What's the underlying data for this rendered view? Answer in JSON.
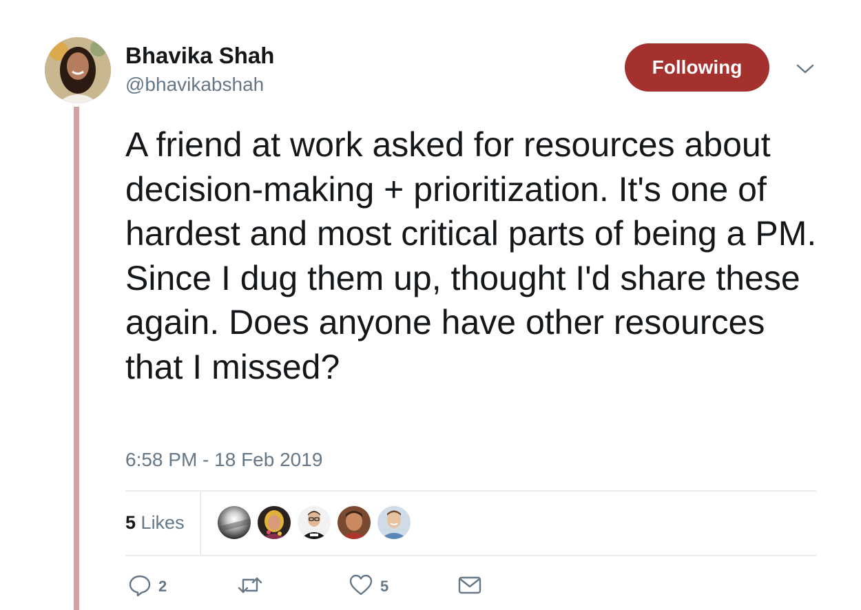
{
  "author": {
    "display_name": "Bhavika Shah",
    "handle": "@bhavikabshah"
  },
  "follow_button_label": "Following",
  "tweet": {
    "text": "A friend at work asked for resources about decision-making + prioritization. It's one of hardest and most critical parts of being a PM. Since I dug them up, thought I'd share these again. Does anyone have other resources that I missed?",
    "timestamp": "6:58 PM - 18 Feb 2019"
  },
  "likes": {
    "count": "5",
    "label": "Likes"
  },
  "actions": {
    "reply_count": "2",
    "retweet_count": "",
    "like_count": "5"
  },
  "colors": {
    "following_button": "#a5312f",
    "thread_line": "#d3a1a1",
    "secondary_text": "#657786"
  },
  "icons": [
    "chevron-down-icon",
    "reply-icon",
    "retweet-icon",
    "heart-icon",
    "envelope-icon"
  ]
}
